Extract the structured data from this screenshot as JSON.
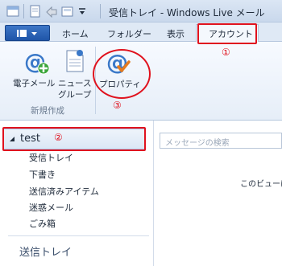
{
  "window": {
    "title": "受信トレイ - Windows Live メール"
  },
  "ribbon": {
    "tabs": [
      {
        "label": "ホーム"
      },
      {
        "label": "フォルダー"
      },
      {
        "label": "表示"
      },
      {
        "label": "アカウント",
        "selected": true
      }
    ],
    "groups": [
      {
        "caption": "新規作成",
        "buttons": [
          {
            "label": "電子メール",
            "icon": "email-account-add-icon"
          },
          {
            "label_line1": "ニュース",
            "label_line2": "グループ",
            "icon": "newsgroup-icon"
          }
        ]
      },
      {
        "buttons": [
          {
            "label": "プロパティ",
            "icon": "properties-at-check-icon"
          }
        ]
      }
    ]
  },
  "folders": {
    "account": "test",
    "items": [
      "受信トレイ",
      "下書き",
      "送信済みアイテム",
      "迷惑メール",
      "ごみ箱"
    ],
    "section": "送信トレイ"
  },
  "search": {
    "placeholder": "メッセージの検索"
  },
  "message_pane": {
    "text": "このビューに"
  },
  "annotations": {
    "one": "①",
    "two": "②",
    "three": "③"
  },
  "colors": {
    "annotation": "#e0121e",
    "file_button": "#2a62b5",
    "accent": "#3a78c8"
  }
}
